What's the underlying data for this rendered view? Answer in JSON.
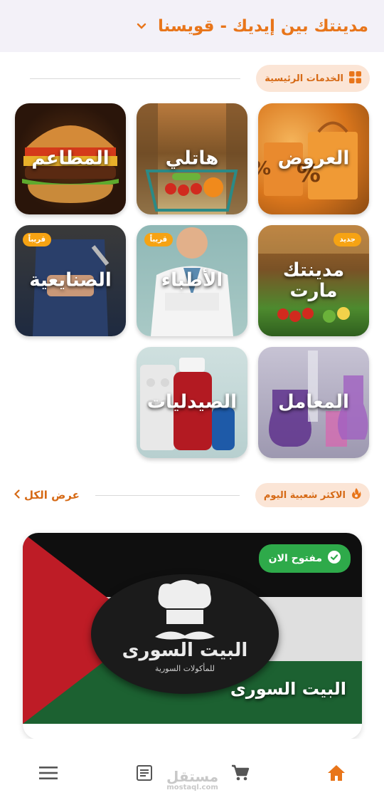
{
  "header": {
    "city_title": "مدينتك بين إيديك - قويسنا",
    "dropdown_icon": "chevron-down-icon"
  },
  "main_services": {
    "title": "الخدمات الرئيسية",
    "icon": "grid-icon",
    "tiles": [
      {
        "label": "العروض",
        "badge": ""
      },
      {
        "label": "هاتلي",
        "badge": ""
      },
      {
        "label": "المطاعم",
        "badge": ""
      },
      {
        "label": "مدينتك مارت",
        "badge": "جديد"
      },
      {
        "label": "الأطباء",
        "badge": "قريباً"
      },
      {
        "label": "الصنايعية",
        "badge": "قريباً"
      },
      {
        "label": "المعامل",
        "badge": ""
      },
      {
        "label": "الصيدليات",
        "badge": ""
      }
    ]
  },
  "popular": {
    "title": "الاكثر شعبية اليوم",
    "icon": "fire-icon",
    "see_all": "عرض الكل"
  },
  "featured_card": {
    "name": "البيت السورى",
    "status": "مفتوح الان",
    "logo_text": "البيت السورى",
    "logo_subtext": "للمأكولات السورية"
  },
  "bottom_nav": {
    "items": [
      "home-icon",
      "cart-icon",
      "orders-icon",
      "menu-icon"
    ]
  },
  "watermark": {
    "line1": "مستقل",
    "line2": "mostaql.com"
  },
  "colors": {
    "accent": "#e8751a",
    "header_bg": "#f3f1f8",
    "pill_bg": "#fbe5d6",
    "badge": "#f6a313",
    "open_green": "#2eaa4a"
  }
}
